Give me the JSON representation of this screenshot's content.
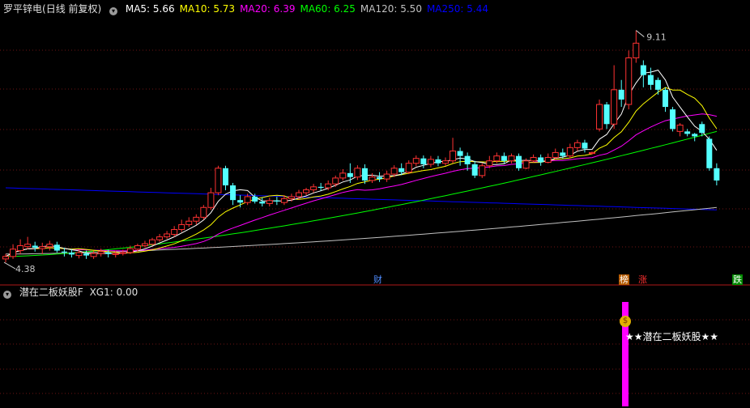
{
  "header": {
    "stock": "罗平锌电",
    "period": "(日线 前复权)",
    "ma": [
      {
        "label": "MA5: 5.66",
        "color": "#ffffff"
      },
      {
        "label": "MA10: 5.73",
        "color": "#ffff00"
      },
      {
        "label": "MA20: 6.39",
        "color": "#ff00ff"
      },
      {
        "label": "MA60: 6.25",
        "color": "#00ff00"
      },
      {
        "label": "MA120: 5.50",
        "color": "#c0c0c0"
      },
      {
        "label": "MA250: 5.44",
        "color": "#0000ff"
      }
    ]
  },
  "indicator": {
    "title": "潜在二板妖股F",
    "value": "XG1: 0.00",
    "signal_text": "★★潜在二板妖股★★"
  },
  "markers": {
    "cai": "财",
    "bang": "榜",
    "zhang": "涨",
    "die": "跌"
  },
  "chart_data": {
    "type": "candlestick",
    "high_label": "9.11",
    "low_label": "4.38",
    "ylim": [
      4.2,
      9.4
    ],
    "grid": true,
    "colors": {
      "up": "#ff3232",
      "down": "#54ffff",
      "ma5": "#ffffff",
      "ma10": "#ffff00",
      "ma20": "#ff00ff",
      "ma60": "#00ff00",
      "ma120": "#c0c0c0",
      "ma250": "#0000ff"
    },
    "candles": [
      [
        4.45,
        4.5,
        4.55,
        4.38
      ],
      [
        4.5,
        4.65,
        4.75,
        4.45
      ],
      [
        4.62,
        4.72,
        4.85,
        4.55
      ],
      [
        4.7,
        4.75,
        4.9,
        4.65
      ],
      [
        4.72,
        4.68,
        4.8,
        4.6
      ],
      [
        4.66,
        4.7,
        4.78,
        4.55
      ],
      [
        4.7,
        4.75,
        4.82,
        4.62
      ],
      [
        4.74,
        4.62,
        4.8,
        4.58
      ],
      [
        4.6,
        4.58,
        4.68,
        4.5
      ],
      [
        4.58,
        4.54,
        4.65,
        4.48
      ],
      [
        4.52,
        4.58,
        4.64,
        4.46
      ],
      [
        4.56,
        4.52,
        4.62,
        4.45
      ],
      [
        4.5,
        4.56,
        4.62,
        4.45
      ],
      [
        4.56,
        4.6,
        4.66,
        4.5
      ],
      [
        4.58,
        4.55,
        4.64,
        4.48
      ],
      [
        4.54,
        4.56,
        4.62,
        4.48
      ],
      [
        4.56,
        4.58,
        4.64,
        4.52
      ],
      [
        4.58,
        4.66,
        4.72,
        4.55
      ],
      [
        4.65,
        4.72,
        4.76,
        4.6
      ],
      [
        4.72,
        4.76,
        4.82,
        4.68
      ],
      [
        4.75,
        4.84,
        4.88,
        4.72
      ],
      [
        4.84,
        4.9,
        4.96,
        4.8
      ],
      [
        4.9,
        4.96,
        5.02,
        4.86
      ],
      [
        4.95,
        5.05,
        5.12,
        4.9
      ],
      [
        5.05,
        5.15,
        5.25,
        5.0
      ],
      [
        5.15,
        5.22,
        5.3,
        5.1
      ],
      [
        5.22,
        5.3,
        5.36,
        5.15
      ],
      [
        5.3,
        5.5,
        5.55,
        5.25
      ],
      [
        5.5,
        5.8,
        5.9,
        5.45
      ],
      [
        5.8,
        6.3,
        6.35,
        5.75
      ],
      [
        6.3,
        5.95,
        6.35,
        5.85
      ],
      [
        5.95,
        5.65,
        6.0,
        5.55
      ],
      [
        5.65,
        5.6,
        5.75,
        5.5
      ],
      [
        5.6,
        5.72,
        5.78,
        5.55
      ],
      [
        5.72,
        5.62,
        5.78,
        5.58
      ],
      [
        5.62,
        5.58,
        5.7,
        5.52
      ],
      [
        5.58,
        5.64,
        5.7,
        5.52
      ],
      [
        5.64,
        5.62,
        5.72,
        5.55
      ],
      [
        5.6,
        5.68,
        5.75,
        5.55
      ],
      [
        5.68,
        5.72,
        5.78,
        5.62
      ],
      [
        5.72,
        5.8,
        5.86,
        5.66
      ],
      [
        5.8,
        5.86,
        5.9,
        5.75
      ],
      [
        5.86,
        5.92,
        5.98,
        5.8
      ],
      [
        5.92,
        5.9,
        6.0,
        5.84
      ],
      [
        5.9,
        5.98,
        6.05,
        5.85
      ],
      [
        5.98,
        6.1,
        6.15,
        5.92
      ],
      [
        6.1,
        6.2,
        6.28,
        6.05
      ],
      [
        6.2,
        6.12,
        6.4,
        6.0
      ],
      [
        6.12,
        6.3,
        6.36,
        6.06
      ],
      [
        6.3,
        6.05,
        6.38,
        5.98
      ],
      [
        6.05,
        6.12,
        6.2,
        6.0
      ],
      [
        6.12,
        6.08,
        6.22,
        6.02
      ],
      [
        6.08,
        6.18,
        6.25,
        6.02
      ],
      [
        6.18,
        6.3,
        6.36,
        6.12
      ],
      [
        6.3,
        6.22,
        6.4,
        6.16
      ],
      [
        6.22,
        6.4,
        6.46,
        6.18
      ],
      [
        6.4,
        6.5,
        6.56,
        6.34
      ],
      [
        6.5,
        6.38,
        6.56,
        6.3
      ],
      [
        6.38,
        6.48,
        6.55,
        6.32
      ],
      [
        6.48,
        6.4,
        6.55,
        6.34
      ],
      [
        6.4,
        6.45,
        6.52,
        6.35
      ],
      [
        6.45,
        6.65,
        6.92,
        6.4
      ],
      [
        6.65,
        6.55,
        6.72,
        6.35
      ],
      [
        6.55,
        6.38,
        6.62,
        6.25
      ],
      [
        6.38,
        6.15,
        6.45,
        6.1
      ],
      [
        6.15,
        6.35,
        6.4,
        6.1
      ],
      [
        6.35,
        6.45,
        6.55,
        6.3
      ],
      [
        6.45,
        6.55,
        6.62,
        6.4
      ],
      [
        6.55,
        6.45,
        6.62,
        6.4
      ],
      [
        6.45,
        6.55,
        6.6,
        6.4
      ],
      [
        6.55,
        6.3,
        6.6,
        6.25
      ],
      [
        6.3,
        6.45,
        6.5,
        6.28
      ],
      [
        6.45,
        6.52,
        6.58,
        6.42
      ],
      [
        6.52,
        6.42,
        6.58,
        6.35
      ],
      [
        6.42,
        6.52,
        6.6,
        6.4
      ],
      [
        6.52,
        6.62,
        6.7,
        6.48
      ],
      [
        6.62,
        6.55,
        6.7,
        6.5
      ],
      [
        6.55,
        6.72,
        6.8,
        6.5
      ],
      [
        6.72,
        6.82,
        6.88,
        6.65
      ],
      [
        6.82,
        6.7,
        6.88,
        6.62
      ],
      [
        6.6,
        6.62,
        6.64,
        6.58
      ],
      [
        7.1,
        7.6,
        7.7,
        7.05
      ],
      [
        7.6,
        7.2,
        7.65,
        7.1
      ],
      [
        7.2,
        7.9,
        8.4,
        7.1
      ],
      [
        7.9,
        7.7,
        8.1,
        7.55
      ],
      [
        7.6,
        8.55,
        8.7,
        7.5
      ],
      [
        8.55,
        8.85,
        9.11,
        8.45
      ],
      [
        8.4,
        8.2,
        8.5,
        7.95
      ],
      [
        8.2,
        8.0,
        8.35,
        7.9
      ],
      [
        8.1,
        7.9,
        8.15,
        7.8
      ],
      [
        7.9,
        7.55,
        7.95,
        7.45
      ],
      [
        7.5,
        7.1,
        7.55,
        7.05
      ],
      [
        7.05,
        7.18,
        7.22,
        6.95
      ],
      [
        7.05,
        7.0,
        7.1,
        6.95
      ],
      [
        7.0,
        6.95,
        7.02,
        6.85
      ],
      [
        7.2,
        7.02,
        7.25,
        6.95
      ],
      [
        6.9,
        6.3,
        6.95,
        6.25
      ],
      [
        6.3,
        6.05,
        6.4,
        5.95
      ]
    ]
  }
}
